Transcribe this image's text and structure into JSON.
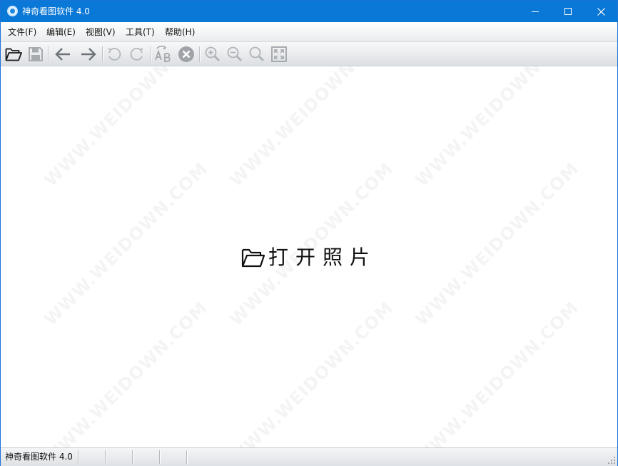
{
  "window": {
    "title": "神奇看图软件 4.0",
    "accent_color": "#0a78d7"
  },
  "menu": {
    "items": [
      {
        "label": "文件(F)"
      },
      {
        "label": "编辑(E)"
      },
      {
        "label": "视图(V)"
      },
      {
        "label": "工具(T)"
      },
      {
        "label": "帮助(H)"
      }
    ]
  },
  "toolbar": {
    "buttons": [
      {
        "icon": "folder-open-icon",
        "enabled": true
      },
      {
        "icon": "save-icon",
        "enabled": false
      },
      {
        "icon": "arrow-left-icon",
        "enabled": true
      },
      {
        "icon": "arrow-right-icon",
        "enabled": true
      },
      {
        "icon": "rotate-left-icon",
        "enabled": false
      },
      {
        "icon": "rotate-right-icon",
        "enabled": false
      },
      {
        "icon": "rename-ab-icon",
        "enabled": false
      },
      {
        "icon": "delete-circle-x-icon",
        "enabled": false
      },
      {
        "icon": "zoom-in-icon",
        "enabled": false
      },
      {
        "icon": "zoom-out-icon",
        "enabled": false
      },
      {
        "icon": "zoom-actual-icon",
        "enabled": false
      },
      {
        "icon": "fit-window-icon",
        "enabled": false
      }
    ]
  },
  "main": {
    "open_photo_label": "打开照片",
    "watermark_text": "WWW.WEIDOWN.COM"
  },
  "status": {
    "text": "神奇看图软件 4.0"
  }
}
